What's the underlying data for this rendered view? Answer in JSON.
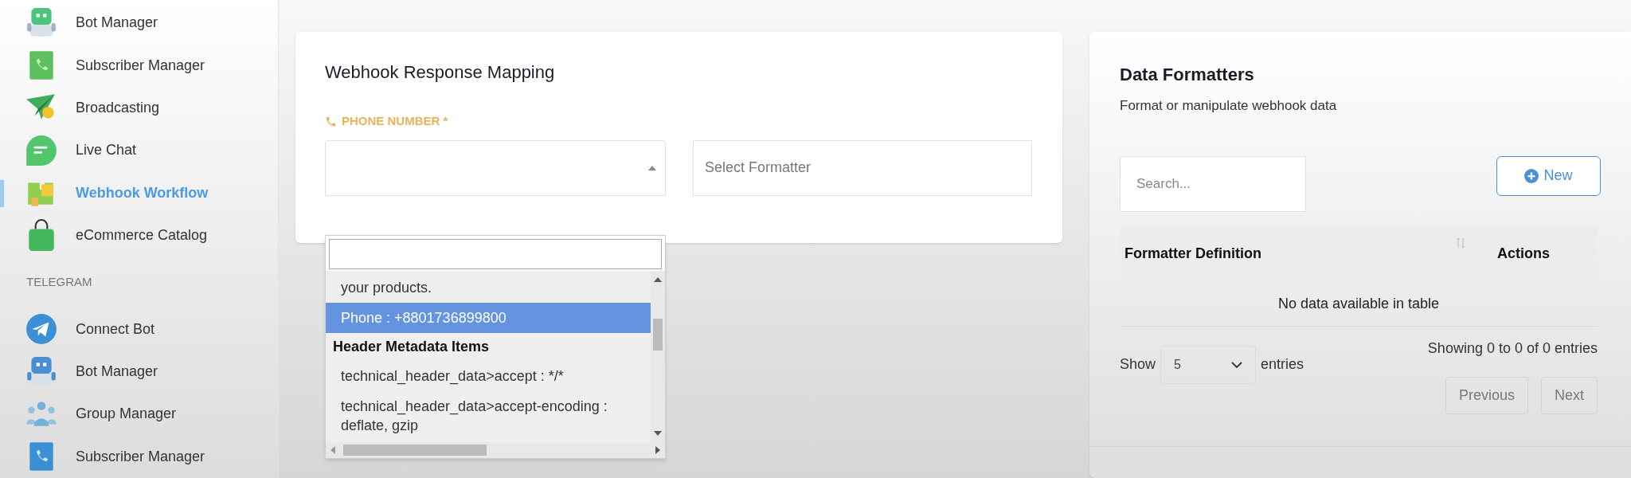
{
  "sidebar": {
    "groups": [
      {
        "items": [
          {
            "label": "Bot Manager",
            "selected": false
          },
          {
            "label": "Subscriber Manager",
            "selected": false
          },
          {
            "label": "Broadcasting",
            "selected": false
          },
          {
            "label": "Live Chat",
            "selected": false
          },
          {
            "label": "Webhook Workflow",
            "selected": true
          },
          {
            "label": "eCommerce Catalog",
            "selected": false
          }
        ]
      },
      {
        "heading": "TELEGRAM",
        "items": [
          {
            "label": "Connect Bot",
            "selected": false
          },
          {
            "label": "Bot Manager",
            "selected": false
          },
          {
            "label": "Group Manager",
            "selected": false
          },
          {
            "label": "Subscriber Manager",
            "selected": false
          }
        ]
      }
    ]
  },
  "mapping": {
    "title": "Webhook Response Mapping",
    "field_label": "PHONE NUMBER *",
    "select": {
      "expanded": true,
      "options": [
        {
          "kind": "option",
          "label": "your products.",
          "selected": false
        },
        {
          "kind": "option",
          "label": "Phone : +8801736899800",
          "selected": true
        },
        {
          "kind": "group",
          "label": "Header Metadata Items"
        },
        {
          "kind": "option",
          "label": "technical_header_data>accept : */*",
          "selected": false
        },
        {
          "kind": "option",
          "label": "technical_header_data>accept-encoding : deflate, gzip",
          "selected": false
        }
      ]
    },
    "formatter": {
      "placeholder": "Select Formatter"
    }
  },
  "formatters": {
    "title": "Data Formatters",
    "subtitle": "Format or manipulate webhook data",
    "search": {
      "placeholder": "Search..."
    },
    "new_button": "New",
    "table": {
      "columns": [
        {
          "label": "Formatter Definition",
          "sortable": true
        },
        {
          "label": "Actions",
          "sortable": false
        }
      ],
      "empty": "No data available in table"
    },
    "show": "Show",
    "page_size": "5",
    "entries": "entries",
    "info": "Showing 0 to 0 of 0 entries",
    "buttons": [
      "Previous",
      "Next"
    ]
  }
}
